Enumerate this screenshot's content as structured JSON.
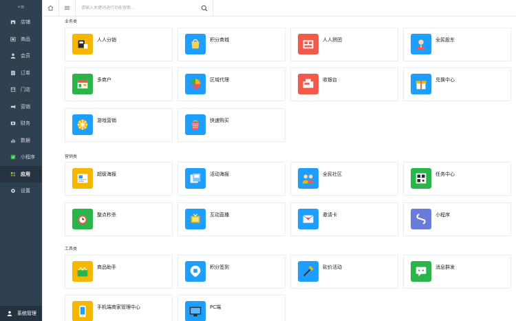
{
  "sidebar": {
    "toggle_label": "«≡",
    "items": [
      {
        "label": "店铺",
        "icon": "shop-icon"
      },
      {
        "label": "商品",
        "icon": "goods-icon"
      },
      {
        "label": "会员",
        "icon": "user-icon"
      },
      {
        "label": "订单",
        "icon": "order-icon"
      },
      {
        "label": "门店",
        "icon": "store-icon"
      },
      {
        "label": "营销",
        "icon": "marketing-icon"
      },
      {
        "label": "财务",
        "icon": "finance-icon"
      },
      {
        "label": "数据",
        "icon": "chart-icon"
      },
      {
        "label": "小程序",
        "icon": "miniprogram-icon"
      },
      {
        "label": "应用",
        "icon": "apps-icon",
        "active": true
      },
      {
        "label": "设置",
        "icon": "gear-icon"
      }
    ],
    "bottom_label": "系统管理"
  },
  "topbar": {
    "search_placeholder": "请输入关键词进行功能搜索..."
  },
  "sections": [
    {
      "title": "业务类",
      "cards": [
        {
          "label": "人人分销",
          "color": "#f5b800"
        },
        {
          "label": "积分商城",
          "color": "#1e9fff"
        },
        {
          "label": "人人拼团",
          "color": "#f25b4b"
        },
        {
          "label": "全民股东",
          "color": "#1e9fff"
        },
        {
          "label": "多商户",
          "color": "#2ab54a"
        },
        {
          "label": "区域代理",
          "color": "#1e9fff"
        },
        {
          "label": "收银台",
          "color": "#f25b4b"
        },
        {
          "label": "兑换中心",
          "color": "#1e9fff"
        },
        {
          "label": "游戏营销",
          "color": "#1e9fff"
        },
        {
          "label": "快速购买",
          "color": "#1e9fff"
        }
      ]
    },
    {
      "title": "营销类",
      "cards": [
        {
          "label": "超级海报",
          "color": "#f5b800"
        },
        {
          "label": "活动海报",
          "color": "#1e9fff"
        },
        {
          "label": "全民社区",
          "color": "#1e9fff"
        },
        {
          "label": "任务中心",
          "color": "#2ab54a"
        },
        {
          "label": "整点秒杀",
          "color": "#2ab54a"
        },
        {
          "label": "互动直播",
          "color": "#1e9fff"
        },
        {
          "label": "邀请卡",
          "color": "#1e9fff"
        },
        {
          "label": "小程序",
          "color": "#6b7bd9"
        }
      ]
    },
    {
      "title": "工具类",
      "cards": [
        {
          "label": "商品助手",
          "color": "#f5b800"
        },
        {
          "label": "积分签到",
          "color": "#1e9fff"
        },
        {
          "label": "砍价活动",
          "color": "#1e9fff"
        },
        {
          "label": "消息群发",
          "color": "#2ab54a"
        },
        {
          "label": "手机端商家管理中心",
          "color": "#f5b800"
        },
        {
          "label": "PC端",
          "color": "#1e9fff"
        }
      ]
    }
  ]
}
